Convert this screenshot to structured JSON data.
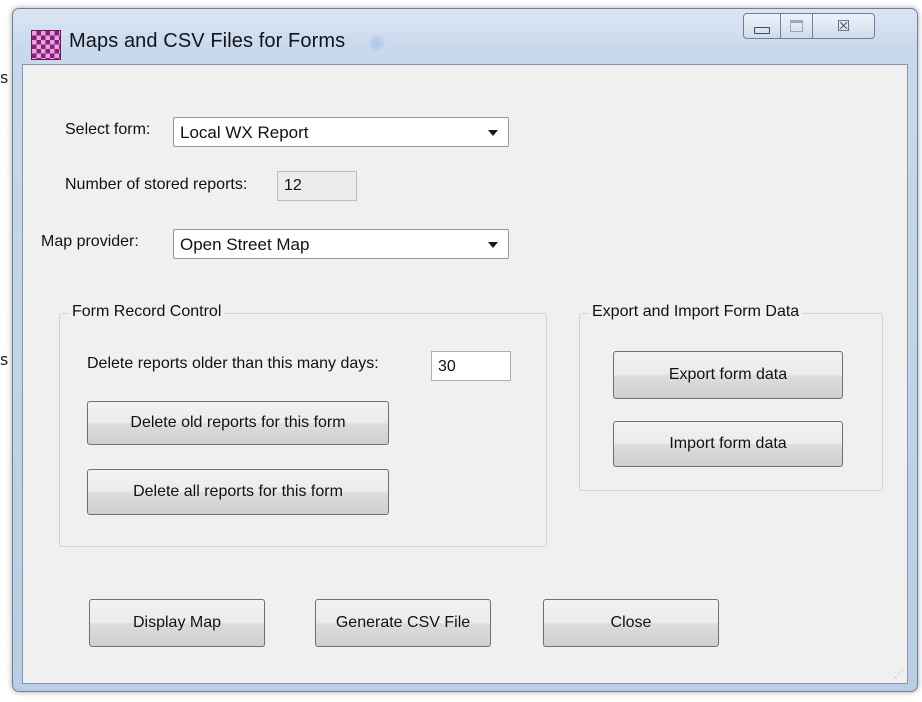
{
  "window": {
    "title": "Maps and CSV Files for Forms",
    "icon": "checkered-app-icon",
    "controls": {
      "minimize": "minimize-icon",
      "maximize": "maximize-icon",
      "close_glyph": "☒"
    }
  },
  "background": {
    "char_1": "s",
    "char_2": "s"
  },
  "form": {
    "select_form_label": "Select form:",
    "select_form_value": "Local WX Report",
    "stored_reports_label": "Number of stored reports:",
    "stored_reports_value": "12",
    "map_provider_label": "Map provider:",
    "map_provider_value": "Open Street Map"
  },
  "record_control": {
    "title": "Form Record Control",
    "delete_days_label": "Delete reports older than this many days:",
    "delete_days_value": "30",
    "delete_old_button": "Delete old reports for this form",
    "delete_all_button": "Delete all reports for this form"
  },
  "export_import": {
    "title": "Export and Import Form Data",
    "export_button": "Export form data",
    "import_button": "Import form data"
  },
  "footer": {
    "display_map_button": "Display Map",
    "generate_csv_button": "Generate CSV File",
    "close_button": "Close"
  },
  "colors": {
    "client_bg": "#f0f0f0",
    "frame_blue": "#c9d9ec",
    "icon_purple": "#8b1f7e"
  }
}
